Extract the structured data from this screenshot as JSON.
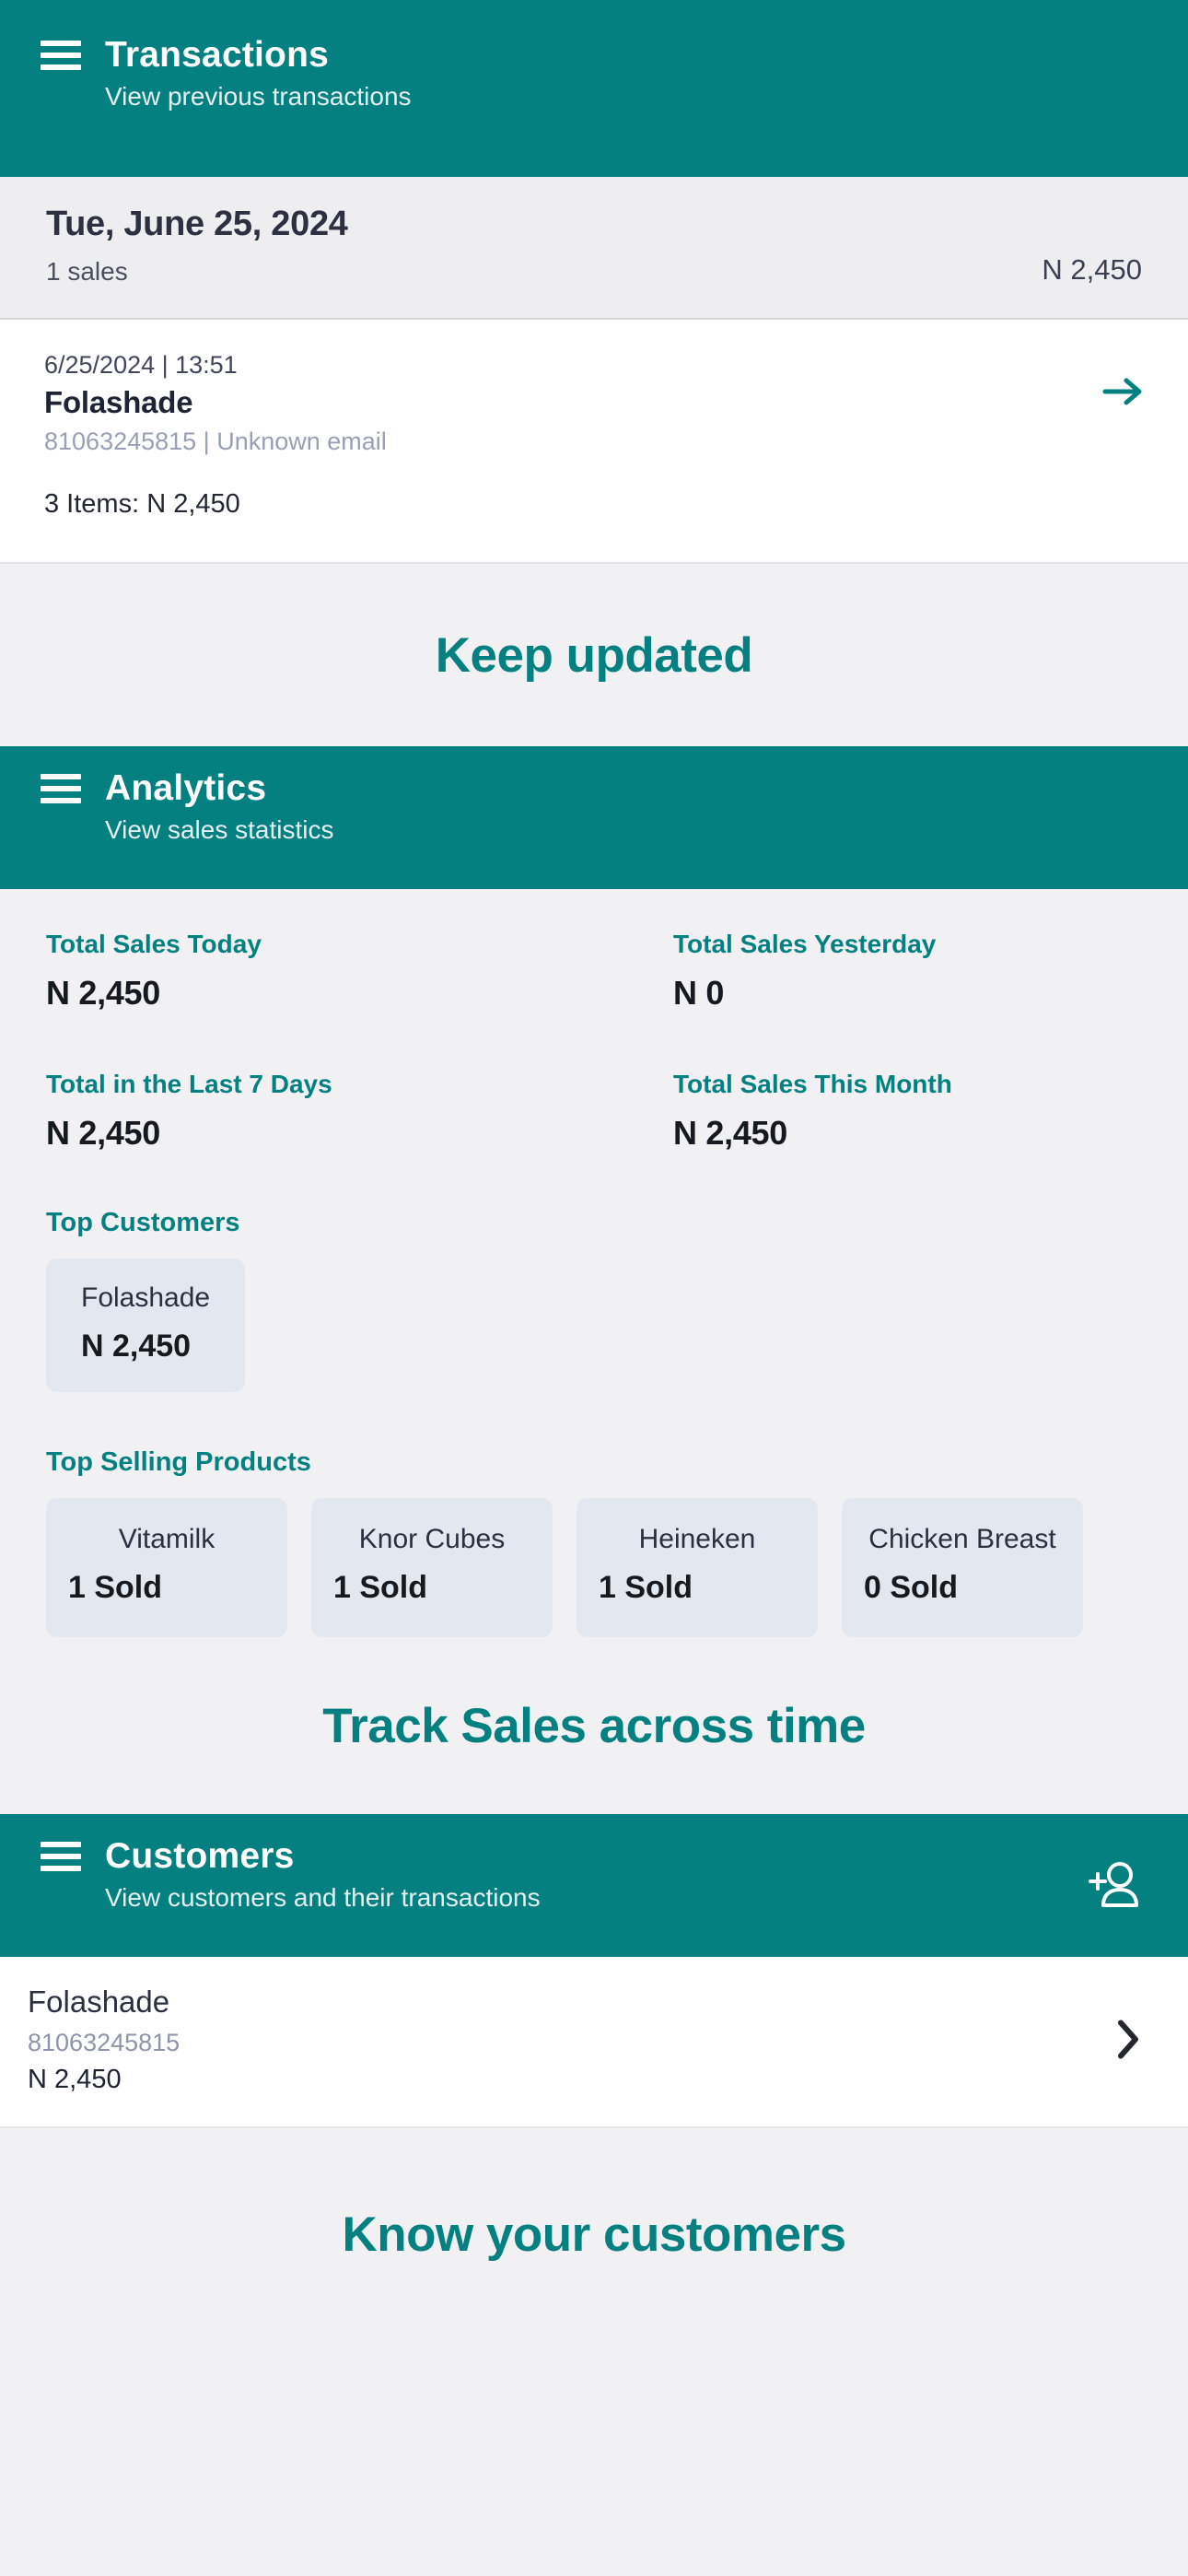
{
  "transactions": {
    "title": "Transactions",
    "subtitle": "View previous transactions",
    "menu_icon": "hamburger-icon",
    "date_group": {
      "date": "Tue, June 25, 2024",
      "sales_count": "1 sales",
      "day_total": "N 2,450"
    },
    "items": [
      {
        "datetime": "6/25/2024 | 13:51",
        "name": "Folashade",
        "contact": "81063245815 | Unknown email",
        "summary": "3 Items:  N 2,450",
        "arrow_icon": "arrow-right-icon"
      }
    ]
  },
  "promo_one": {
    "text": "Keep updated"
  },
  "analytics": {
    "title": "Analytics",
    "subtitle": "View sales statistics",
    "menu_icon": "hamburger-icon",
    "stats": [
      {
        "label": "Total Sales Today",
        "value": "N 2,450"
      },
      {
        "label": "Total Sales Yesterday",
        "value": "N 0"
      },
      {
        "label": "Total in the Last 7 Days",
        "value": "N 2,450"
      },
      {
        "label": "Total Sales This Month",
        "value": "N 2,450"
      }
    ],
    "top_customers_label": "Top Customers",
    "top_customers": [
      {
        "name": "Folashade",
        "value": "N 2,450"
      }
    ],
    "top_products_label": "Top Selling Products",
    "top_products": [
      {
        "name": "Vitamilk",
        "value": "1 Sold"
      },
      {
        "name": "Knor Cubes",
        "value": "1 Sold"
      },
      {
        "name": "Heineken",
        "value": "1 Sold"
      },
      {
        "name": "Chicken Breast",
        "value": "0 Sold"
      }
    ]
  },
  "promo_two": {
    "text": "Track Sales across time"
  },
  "customers": {
    "title": "Customers",
    "subtitle": "View customers and their transactions",
    "menu_icon": "hamburger-icon",
    "add_icon": "person-add-icon",
    "rows": [
      {
        "name": "Folashade",
        "phone": "81063245815",
        "total": "N 2,450",
        "chevron_icon": "chevron-right-icon"
      }
    ]
  },
  "promo_three": {
    "text": "Know your customers"
  },
  "colors": {
    "teal": "#058080",
    "page_bg": "#f1f1f3",
    "card_bg": "#ffffff",
    "chip_bg": "#e2e7f0",
    "muted_text": "#9aa0b4"
  }
}
